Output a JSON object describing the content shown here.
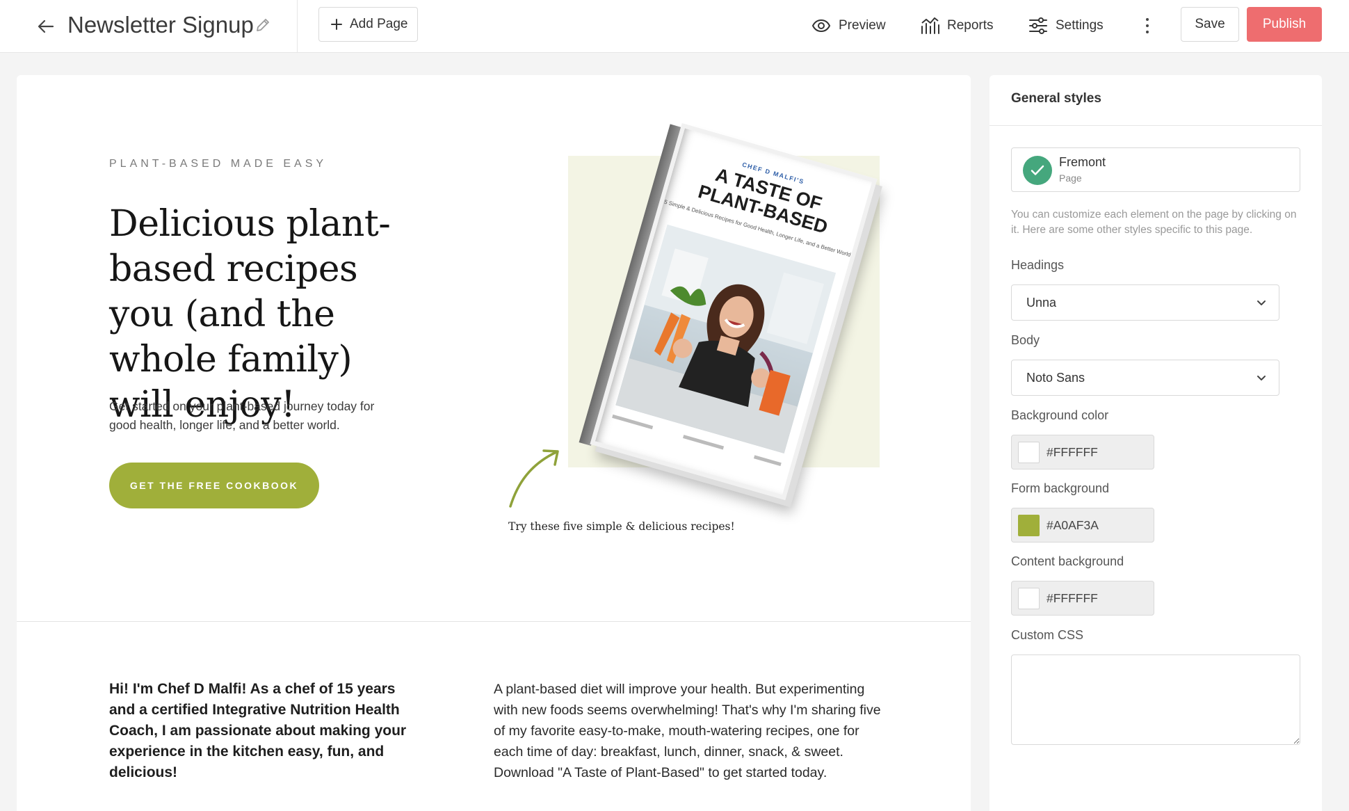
{
  "header": {
    "page_title": "Newsletter Signup",
    "add_page_label": "Add Page",
    "preview_label": "Preview",
    "reports_label": "Reports",
    "settings_label": "Settings",
    "save_label": "Save",
    "publish_label": "Publish",
    "publish_color": "#EE6D6F"
  },
  "hero": {
    "eyebrow": "PLANT-BASED MADE EASY",
    "headline": "Delicious plant-based recipes you (and the whole family) will enjoy!",
    "subtext": "Get started on your plant-based journey today for good health, longer life, and a better world.",
    "cta_label": "GET THE FREE COOKBOOK",
    "caption": "Try these five simple & delicious recipes!"
  },
  "book": {
    "author": "CHEF D MALFI'S",
    "title_line1": "A TASTE OF",
    "title_line2": "PLANT-BASED",
    "subtitle": "5 Simple & Delicious Recipes for Good Health, Longer Life, and a Better World"
  },
  "about": {
    "left": "Hi! I'm Chef D Malfi! As a chef of 15 years and a certified Integrative Nutrition Health Coach, I am passionate about making your experience in the kitchen easy, fun, and delicious!",
    "right": "A plant-based diet will improve your health. But experimenting with new foods seems overwhelming! That's why I'm sharing five of my favorite easy-to-make, mouth-watering recipes, one for each time of day: breakfast, lunch, dinner, snack, & sweet. Download \"A Taste of Plant-Based\" to get started today."
  },
  "panel": {
    "title": "General styles",
    "theme_name": "Fremont",
    "theme_type": "Page",
    "helper": "You can customize each element on the page by clicking on it. Here are some other styles specific to this page.",
    "headings_label": "Headings",
    "headings_value": "Unna",
    "body_label": "Body",
    "body_value": "Noto Sans",
    "bg_color_label": "Background color",
    "bg_color_value": "#FFFFFF",
    "form_bg_label": "Form background",
    "form_bg_value": "#A0AF3A",
    "content_bg_label": "Content background",
    "content_bg_value": "#FFFFFF",
    "custom_css_label": "Custom CSS"
  },
  "colors": {
    "accent_green": "#A0AF3A",
    "check_green": "#45A77D"
  }
}
